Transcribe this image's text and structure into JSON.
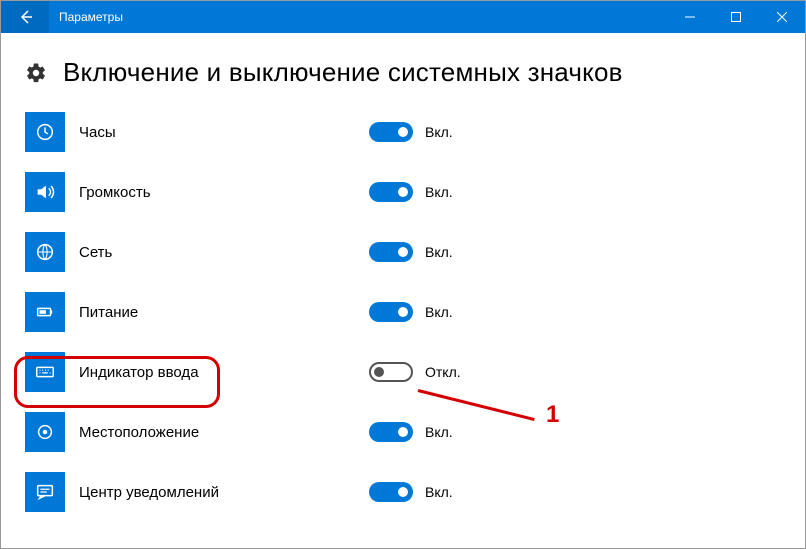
{
  "window": {
    "title": "Параметры"
  },
  "page": {
    "heading": "Включение и выключение системных значков"
  },
  "states": {
    "on": "Вкл.",
    "off": "Откл."
  },
  "items": [
    {
      "key": "clock",
      "label": "Часы",
      "on": true
    },
    {
      "key": "volume",
      "label": "Громкость",
      "on": true
    },
    {
      "key": "network",
      "label": "Сеть",
      "on": true
    },
    {
      "key": "power",
      "label": "Питание",
      "on": true
    },
    {
      "key": "input",
      "label": "Индикатор ввода",
      "on": false
    },
    {
      "key": "location",
      "label": "Местоположение",
      "on": true
    },
    {
      "key": "actioncenter",
      "label": "Центр уведомлений",
      "on": true
    }
  ],
  "annotation": {
    "label": "1"
  }
}
